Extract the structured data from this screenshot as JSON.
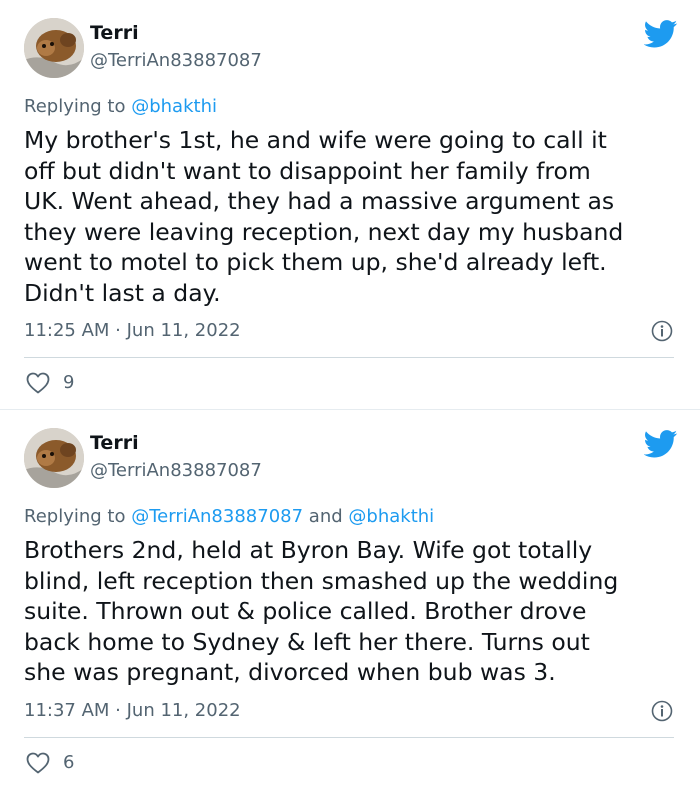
{
  "colors": {
    "link": "#1d9bf0",
    "text": "#0f1419",
    "muted": "#536471",
    "twitter_blue": "#1d9bf0"
  },
  "icons": {
    "brand": "twitter-bird-icon",
    "info": "info-icon",
    "like": "heart-icon"
  },
  "tweets": [
    {
      "author_name": "Terri",
      "author_handle": "@TerriAn83887087",
      "reply_prefix": "Replying to",
      "reply_mentions": "@bhakthi",
      "reply_and": "",
      "reply_mentions2": "",
      "lines": [
        "My brother's 1st, he and wife were going to call it",
        "off but didn't want to disappoint her family from",
        "UK. Went ahead, they had a massive argument as",
        "they were leaving reception, next day my husband",
        "went to motel to pick them up, she'd already left.",
        "Didn't last a day."
      ],
      "timestamp": "11:25 AM · Jun 11, 2022",
      "likes": "9"
    },
    {
      "author_name": "Terri",
      "author_handle": "@TerriAn83887087",
      "reply_prefix": "Replying to",
      "reply_mentions": "@TerriAn83887087",
      "reply_and": "and",
      "reply_mentions2": "@bhakthi",
      "lines": [
        "Brothers 2nd, held at Byron Bay. Wife got totally",
        "blind, left reception then smashed up the wedding",
        "suite. Thrown out & police called. Brother drove",
        "back home to Sydney & left her there. Turns out",
        "she was pregnant, divorced when bub was 3."
      ],
      "timestamp": "11:37 AM · Jun 11, 2022",
      "likes": "6"
    }
  ]
}
